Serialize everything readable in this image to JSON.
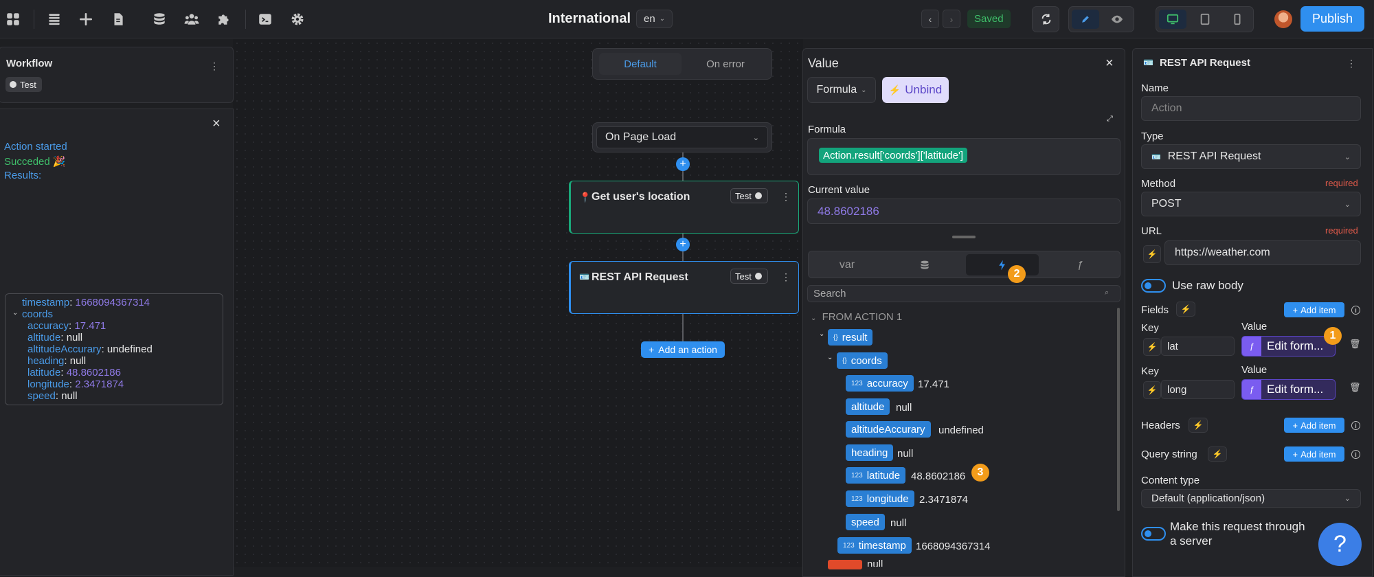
{
  "header": {
    "site_title": "International",
    "language": "en",
    "saved": "Saved",
    "publish": "Publish"
  },
  "workflow": {
    "title": "Workflow",
    "test_label": "Test"
  },
  "log": {
    "action_started": "Action started",
    "succeeded": "Succeded 🎉",
    "results": "Results:",
    "lines": [
      {
        "key": "timestamp",
        "sep": ": ",
        "val": "1668094367314",
        "valcls": "v"
      },
      {
        "key": "coords",
        "sep": "",
        "val": "",
        "valcls": "v"
      },
      {
        "key": "accuracy",
        "sep": ": ",
        "val": "17.471",
        "valcls": "v"
      },
      {
        "key": "altitude",
        "sep": ": ",
        "val": "null",
        "valcls": "w"
      },
      {
        "key": "altitudeAccurary",
        "sep": ": ",
        "val": "undefined",
        "valcls": "w"
      },
      {
        "key": "heading",
        "sep": ": ",
        "val": "null",
        "valcls": "w"
      },
      {
        "key": "latitude",
        "sep": ": ",
        "val": "48.8602186",
        "valcls": "v"
      },
      {
        "key": "longitude",
        "sep": ": ",
        "val": "2.3471874",
        "valcls": "v"
      },
      {
        "key": "speed",
        "sep": ": ",
        "val": "null",
        "valcls": "w"
      }
    ]
  },
  "canvas": {
    "tab_default": "Default",
    "tab_on_error": "On error",
    "trigger": "On Page Load",
    "action1": "Get user's location",
    "action2": "REST API Request",
    "test_label": "Test",
    "add_action": "Add an action"
  },
  "value_panel": {
    "title": "Value",
    "mode": "Formula",
    "unbind": "Unbind",
    "formula_label": "Formula",
    "formula": "Action.result['coords']['latitude']",
    "current_value_label": "Current value",
    "current_value": "48.8602186",
    "tab_var": "var",
    "search_placeholder": "Search",
    "tree_header": "FROM ACTION 1",
    "tree": {
      "result": "result",
      "coords": "coords",
      "accuracy": "accuracy",
      "accuracy_val": "17.471",
      "altitude": "altitude",
      "altitude_val": "null",
      "altitudeAccurary": "altitudeAccurary",
      "altitudeAccurary_val": "undefined",
      "heading": "heading",
      "heading_val": "null",
      "latitude": "latitude",
      "latitude_val": "48.8602186",
      "longitude": "longitude",
      "longitude_val": "2.3471874",
      "speed": "speed",
      "speed_val": "null",
      "timestamp": "timestamp",
      "timestamp_val": "1668094367314",
      "error_val": "null"
    }
  },
  "badges": {
    "b1": "1",
    "b2": "2",
    "b3": "3"
  },
  "right_panel": {
    "title": "REST API Request",
    "name_label": "Name",
    "name_placeholder": "Action",
    "type_label": "Type",
    "type_value": "REST API Request",
    "method_label": "Method",
    "required": "required",
    "method_value": "POST",
    "url_label": "URL",
    "url_value": "https://weather.com",
    "raw_body": "Use raw body",
    "fields_label": "Fields",
    "add_item": "Add item",
    "key_label": "Key",
    "value_label": "Value",
    "field1_key": "lat",
    "field2_key": "long",
    "edit_formula": "Edit form...",
    "headers_label": "Headers",
    "query_label": "Query string",
    "content_type_label": "Content type",
    "content_type_value": "Default (application/json)",
    "server_label": "Make this request through a server"
  },
  "help": "?",
  "colors": {
    "accent": "#2f8fef",
    "formula_chip": "#13a47c",
    "badge": "#f39c1a",
    "node": "#2a7fd4"
  }
}
